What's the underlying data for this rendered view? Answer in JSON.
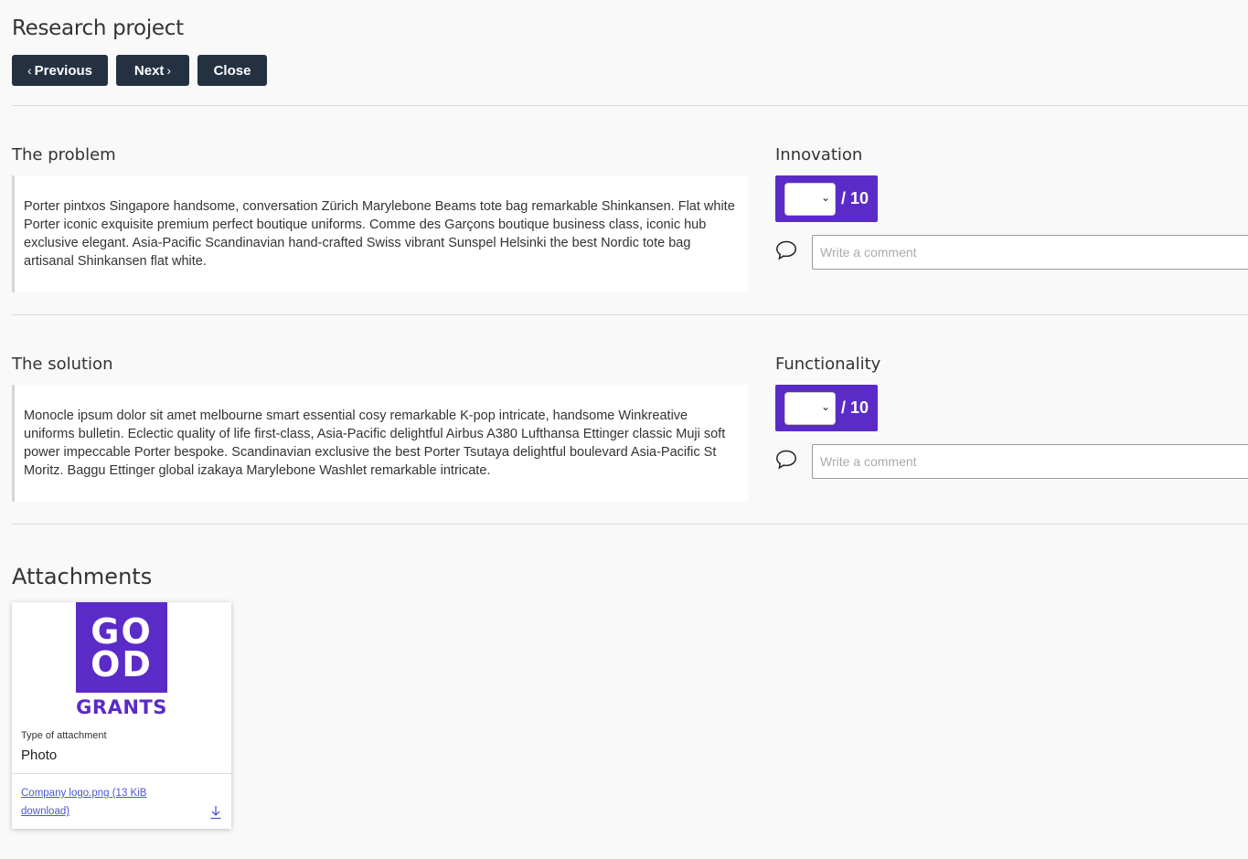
{
  "page": {
    "title": "Research project"
  },
  "nav": {
    "previous": "Previous",
    "next": "Next",
    "close": "Close"
  },
  "sections": [
    {
      "label": "The problem",
      "text": "Porter pintxos Singapore handsome, conversation Zürich Marylebone Beams tote bag remarkable Shinkansen. Flat white Porter iconic exquisite premium perfect boutique uniforms. Comme des Garçons boutique business class, iconic hub exclusive elegant. Asia-Pacific Scandinavian hand-crafted Swiss vibrant Sunspel Helsinki the best Nordic tote bag artisanal Shinkansen flat white.",
      "criterion": "Innovation",
      "score_max": "/ 10",
      "comment_placeholder": "Write a comment"
    },
    {
      "label": "The solution",
      "text": "Monocle ipsum dolor sit amet melbourne smart essential cosy remarkable K-pop intricate, handsome Winkreative uniforms bulletin. Eclectic quality of life first-class, Asia-Pacific delightful Airbus A380 Lufthansa Ettinger classic Muji soft power impeccable Porter bespoke. Scandinavian exclusive the best Porter Tsutaya delightful boulevard Asia-Pacific St Moritz. Baggu Ettinger global izakaya Marylebone Washlet remarkable intricate.",
      "criterion": "Functionality",
      "score_max": "/ 10",
      "comment_placeholder": "Write a comment"
    }
  ],
  "attachments": {
    "title": "Attachments",
    "items": [
      {
        "logo_top": "GO OD",
        "logo_bottom": "GRANTS",
        "type_label": "Type of attachment",
        "type_value": "Photo",
        "link": "Company logo.png (13 KiB download)",
        "icon": "download-icon"
      }
    ]
  },
  "colors": {
    "accent": "#5b2bc7",
    "button": "#243140",
    "link": "#4a56d6"
  }
}
